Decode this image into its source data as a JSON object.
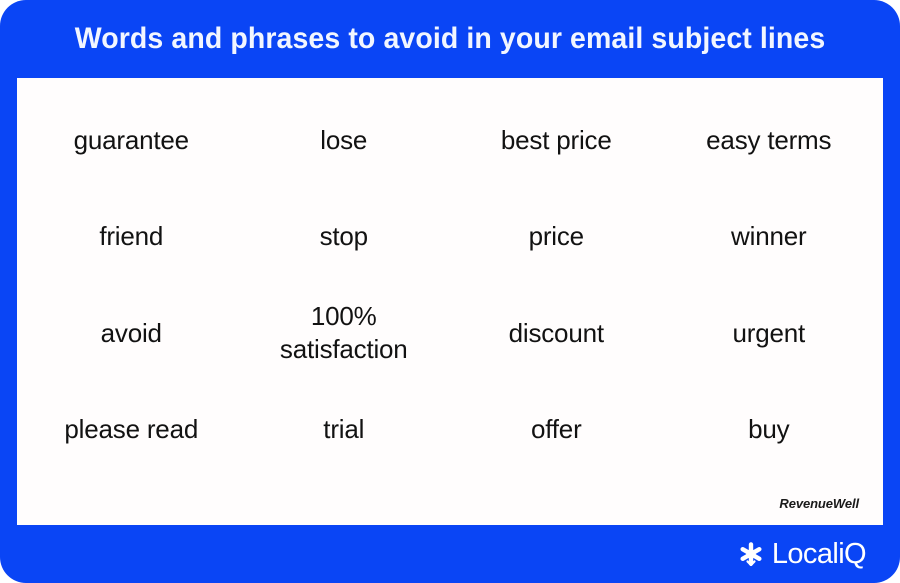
{
  "card": {
    "background_color": "#0a45f5",
    "panel_color": "#fffdfd",
    "title_color": "#f2f6ff",
    "word_color": "#121212"
  },
  "header": {
    "title": "Words and phrases to avoid in your email subject lines"
  },
  "main": {
    "columns": 4,
    "rows": 4,
    "words": [
      "guarantee",
      "lose",
      "best price",
      "easy terms",
      "friend",
      "stop",
      "price",
      "winner",
      "avoid",
      "100%\nsatisfaction",
      "discount",
      "urgent",
      "please read",
      "trial",
      "offer",
      "buy"
    ],
    "attribution": "RevenueWell"
  },
  "footer": {
    "brand_name": "LocaliQ",
    "brand_icon": "asterisk-flower-icon"
  }
}
